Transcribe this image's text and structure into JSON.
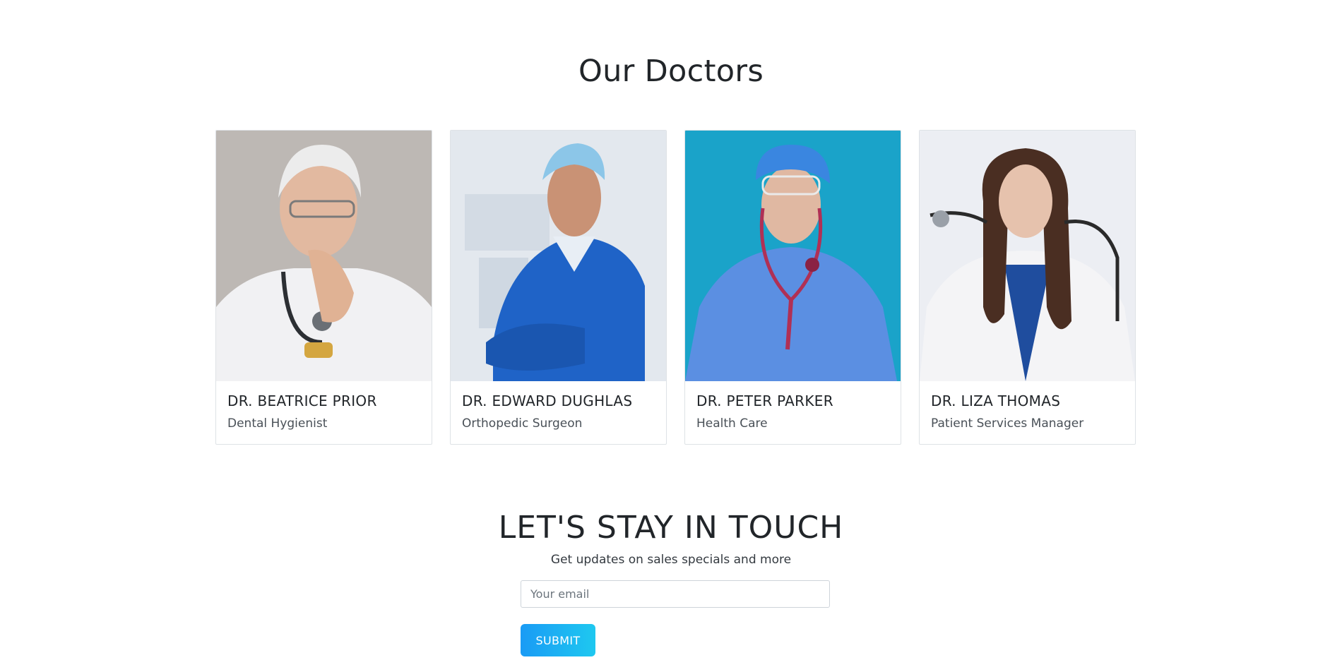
{
  "section_title": "Our Doctors",
  "doctors": [
    {
      "name": "DR. BEATRICE PRIOR",
      "role": "Dental Hygienist",
      "photo_bg": "#bdb8b4"
    },
    {
      "name": "DR. EDWARD DUGHLAS",
      "role": "Orthopedic Surgeon",
      "photo_bg": "#e3e8ee"
    },
    {
      "name": "DR. PETER PARKER",
      "role": "Health Care",
      "photo_bg": "#1aa3c9"
    },
    {
      "name": "DR. LIZA THOMAS",
      "role": "Patient Services Manager",
      "photo_bg": "#eceef3"
    }
  ],
  "newsletter": {
    "title": "LET'S STAY IN TOUCH",
    "subtitle": "Get updates on sales specials and more",
    "email_placeholder": "Your email",
    "submit_label": "SUBMIT"
  }
}
